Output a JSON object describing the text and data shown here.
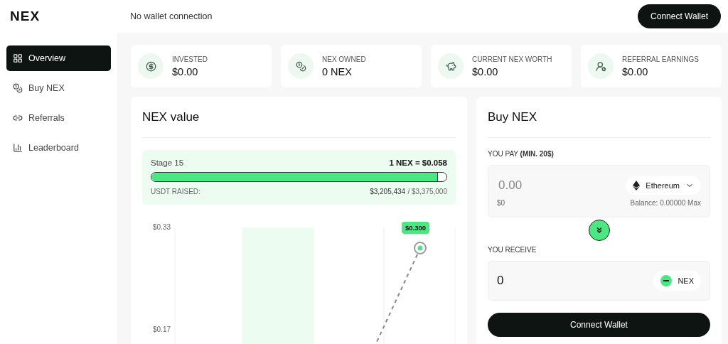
{
  "logo": "NEX",
  "header": {
    "wallet_status": "No wallet connection",
    "connect_button": "Connect Wallet"
  },
  "sidebar": {
    "items": [
      {
        "label": "Overview",
        "selected": true
      },
      {
        "label": "Buy NEX",
        "selected": false
      },
      {
        "label": "Referrals",
        "selected": false
      },
      {
        "label": "Leaderboard",
        "selected": false
      }
    ]
  },
  "stats": [
    {
      "label": "INVESTED",
      "value": "$0.00"
    },
    {
      "label": "NEX OWNED",
      "value": "0 NEX"
    },
    {
      "label": "CURRENT NEX WORTH",
      "value": "$0.00"
    },
    {
      "label": "REFERRAL EARNINGS",
      "value": "$0.00"
    }
  ],
  "value_panel": {
    "title": "NEX value",
    "stage": "Stage 15",
    "price": "1 NEX = $0.058",
    "level": 0.97,
    "raised_label": "USDT RAISED:",
    "raised": "$3,205,434",
    "target": "/ $3,375,000",
    "chart": {
      "y_labels": [
        "$0.33",
        "$0.17"
      ],
      "point_label": "$0.300"
    }
  },
  "buy_panel": {
    "title": "Buy NEX",
    "pay_label": "YOU PAY **(MIN. 20$)**",
    "pay_placeholder": "0.00",
    "pay_usd": "$0",
    "currency": "Ethereum",
    "balance": "Balance: 0.00000 Max",
    "receive_label": "YOU RECEIVE",
    "receive_value": "0",
    "receive_token": "NEX",
    "button": "Connect Wallet"
  }
}
